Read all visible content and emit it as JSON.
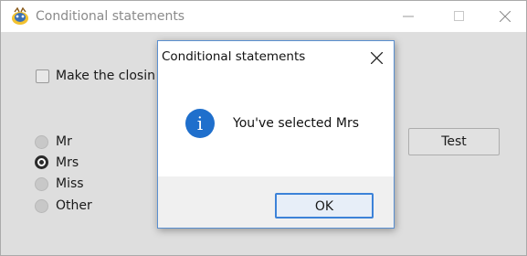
{
  "window": {
    "title": "Conditional statements",
    "controls": [
      "minimize",
      "maximize",
      "close"
    ]
  },
  "main": {
    "checkbox_label": "Make the closin",
    "radios": [
      {
        "label": "Mr",
        "selected": false
      },
      {
        "label": "Mrs",
        "selected": true
      },
      {
        "label": "Miss",
        "selected": false
      },
      {
        "label": "Other",
        "selected": false
      }
    ],
    "test_button": "Test"
  },
  "dialog": {
    "title": "Conditional statements",
    "message": "You've selected Mrs",
    "ok_button": "OK",
    "icon": "information-icon"
  },
  "colors": {
    "accent": "#1f6fcc",
    "focus_border": "#3c82d8",
    "window_bg": "#dedede"
  }
}
